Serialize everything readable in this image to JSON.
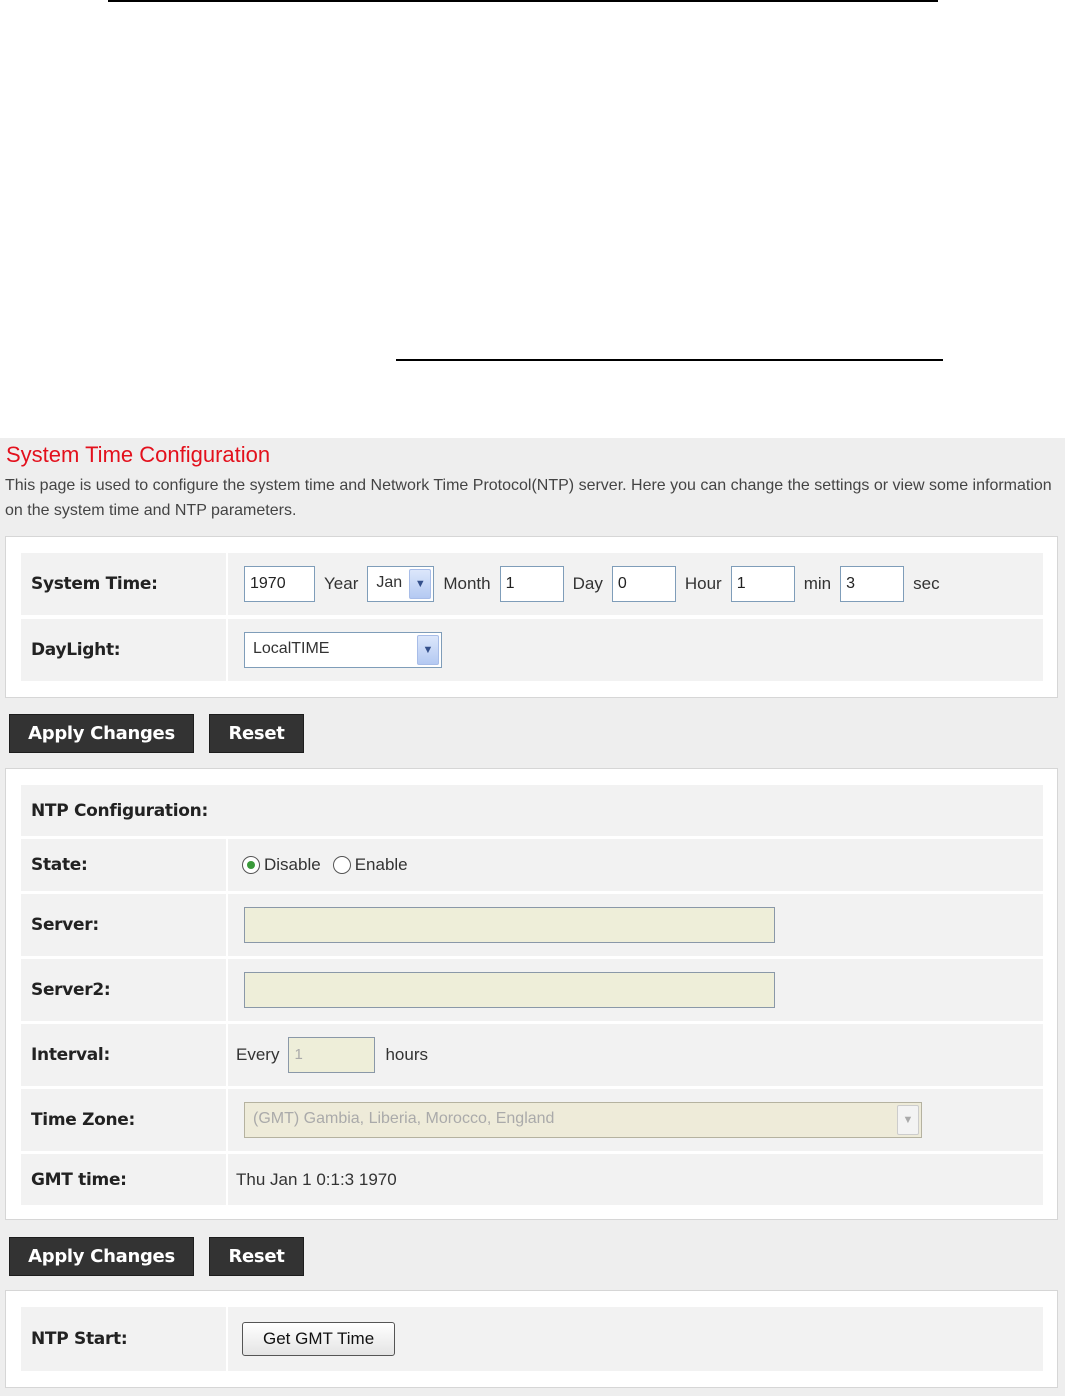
{
  "page": {
    "title": "System Time Configuration",
    "description": "This page is used to configure the system time and Network Time Protocol(NTP) server. Here you can change the settings or view some information on the system time and NTP parameters."
  },
  "system_time": {
    "label": "System Time:",
    "year": "1970",
    "year_unit": "Year",
    "month": "Jan",
    "month_unit": "Month",
    "day": "1",
    "day_unit": "Day",
    "hour": "0",
    "hour_unit": "Hour",
    "min": "1",
    "min_unit": "min",
    "sec": "3",
    "sec_unit": "sec"
  },
  "daylight": {
    "label": "DayLight:",
    "value": "LocalTIME"
  },
  "buttons": {
    "apply": "Apply Changes",
    "reset": "Reset"
  },
  "ntp": {
    "heading": "NTP Configuration:",
    "state_label": "State:",
    "state_options": [
      "Disable",
      "Enable"
    ],
    "state_selected": "Disable",
    "server_label": "Server:",
    "server_value": "",
    "server2_label": "Server2:",
    "server2_value": "",
    "interval_label": "Interval:",
    "interval_prefix": "Every",
    "interval_value": "1",
    "interval_unit": "hours",
    "timezone_label": "Time Zone:",
    "timezone_value": "(GMT) Gambia, Liberia, Morocco, England",
    "gmt_label": "GMT time:",
    "gmt_value": "Thu Jan 1 0:1:3 1970"
  },
  "ntp_start": {
    "label": "NTP Start:",
    "button": "Get GMT Time"
  },
  "colors": {
    "title": "#e3101c",
    "button_bg": "#333333",
    "row_bg": "#f2f2f2",
    "page_bg": "#eeeeee"
  },
  "icons": {
    "select_arrow": "chevron-down-icon"
  }
}
